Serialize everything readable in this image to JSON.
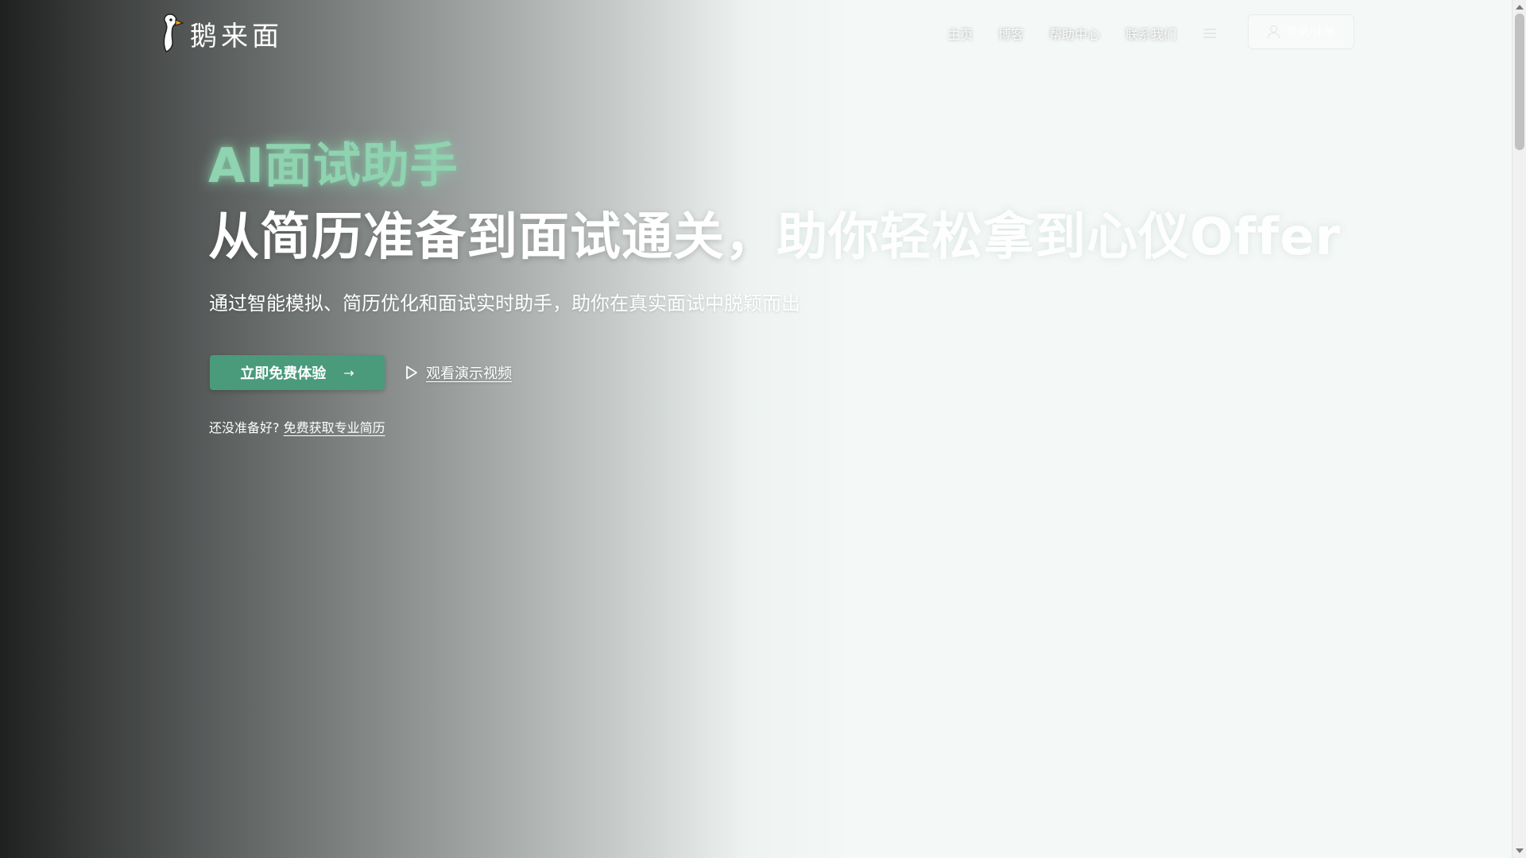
{
  "brand": {
    "name": "鹅来面",
    "logo_icon": "goose-icon"
  },
  "nav": {
    "items": [
      {
        "label": "主页"
      },
      {
        "label": "博客"
      },
      {
        "label": "帮助中心"
      },
      {
        "label": "联系我们"
      }
    ],
    "menu_icon": "menu-icon",
    "login_label": "登录/注册"
  },
  "hero": {
    "kicker": "AI面试助手",
    "title_part1": "从简历准备到面试通关，",
    "title_part2": "助你轻松拿到心仪Offer",
    "subtitle": "通过智能模拟、简历优化和面试实时助手，助你在真实面试中脱颖而出",
    "cta_label": "立即免费体验",
    "video_label": "观看演示视频",
    "resume_prompt": "还没准备好?",
    "resume_link": "免费获取专业简历"
  },
  "colors": {
    "accent": "#4a9a7c",
    "kicker": "#8fd3b0"
  }
}
